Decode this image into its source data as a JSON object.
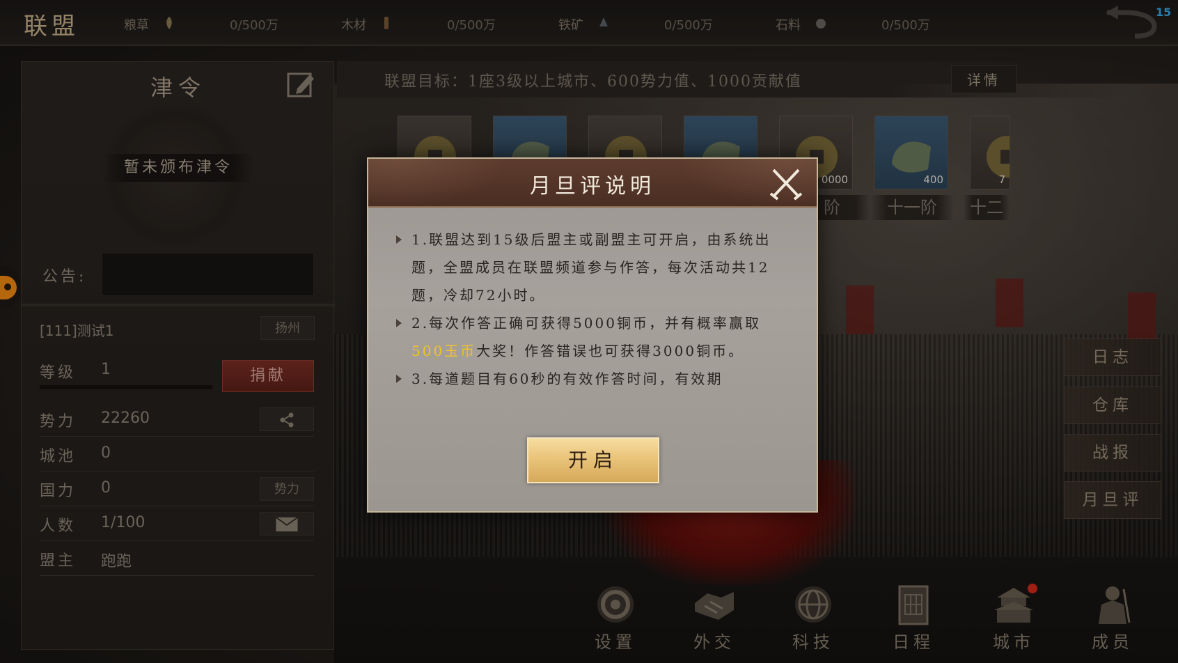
{
  "topbar": {
    "title": "联盟",
    "resources": [
      {
        "label": "粮草",
        "value": "0/500万",
        "icon": "grain-icon"
      },
      {
        "label": "木材",
        "value": "0/500万",
        "icon": "wood-icon"
      },
      {
        "label": "铁矿",
        "value": "0/500万",
        "icon": "iron-icon"
      },
      {
        "label": "石料",
        "value": "0/500万",
        "icon": "stone-icon"
      }
    ],
    "level_badge": "15"
  },
  "left_panel": {
    "decree_title": "津令",
    "decree_status": "暂未颁布津令",
    "announcement_label": "公告:",
    "alliance_name": "[111]测试1",
    "city": "扬州",
    "level_label": "等级",
    "level_value": "1",
    "donate_label": "捐献",
    "power_label": "势力",
    "power_value": "22260",
    "cities_label": "城池",
    "cities_value": "0",
    "national_label": "国力",
    "national_value": "0",
    "national_btn": "势力",
    "members_label": "人数",
    "members_value": "1/100",
    "leader_label": "盟主",
    "leader_value": "跑跑"
  },
  "goal": {
    "text": "联盟目标：1座3级以上城市、600势力值、1000贡献值",
    "detail_label": "详情"
  },
  "rewards": {
    "tiles": [
      {
        "type": "coin",
        "amount": ""
      },
      {
        "type": "jade",
        "amount": ""
      },
      {
        "type": "coin",
        "amount": ""
      },
      {
        "type": "jade",
        "amount": ""
      },
      {
        "type": "coin",
        "amount": "0000"
      },
      {
        "type": "jade",
        "amount": "400"
      },
      {
        "type": "coin",
        "amount": "7"
      }
    ],
    "tiers": [
      "阶",
      "十一阶",
      "十二"
    ]
  },
  "side_buttons": [
    "日志",
    "仓库",
    "战报",
    "月旦评"
  ],
  "bottom_nav": [
    {
      "label": "设置",
      "icon": "settings-gear-icon"
    },
    {
      "label": "外交",
      "icon": "handshake-icon"
    },
    {
      "label": "科技",
      "icon": "globe-tech-icon"
    },
    {
      "label": "日程",
      "icon": "calendar-scroll-icon"
    },
    {
      "label": "城市",
      "icon": "city-palace-icon"
    },
    {
      "label": "成员",
      "icon": "members-warrior-icon"
    }
  ],
  "modal": {
    "title": "月旦评说明",
    "rule1": "1.联盟达到15级后盟主或副盟主可开启，由系统出题，全盟成员在联盟频道参与作答，每次活动共12题，冷却72小时。",
    "rule2_before": "2.每次作答正确可获得5000铜币，并有概率赢取",
    "rule2_highlight": "500玉币",
    "rule2_after": "大奖！作答错误也可获得3000铜币。",
    "rule3": "3.每道题目有60秒的有效作答时间，有效期",
    "open_label": "开启",
    "highlight_color": "#f0c420"
  }
}
